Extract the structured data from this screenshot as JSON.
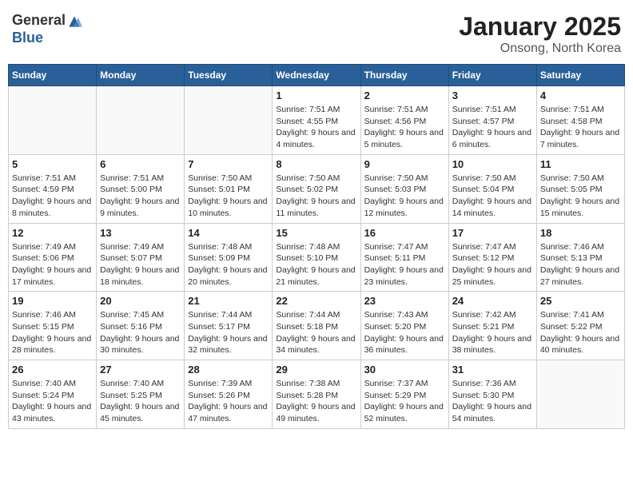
{
  "logo": {
    "general": "General",
    "blue": "Blue"
  },
  "title": "January 2025",
  "subtitle": "Onsong, North Korea",
  "weekdays": [
    "Sunday",
    "Monday",
    "Tuesday",
    "Wednesday",
    "Thursday",
    "Friday",
    "Saturday"
  ],
  "weeks": [
    [
      {
        "day": "",
        "info": ""
      },
      {
        "day": "",
        "info": ""
      },
      {
        "day": "",
        "info": ""
      },
      {
        "day": "1",
        "info": "Sunrise: 7:51 AM\nSunset: 4:55 PM\nDaylight: 9 hours and 4 minutes."
      },
      {
        "day": "2",
        "info": "Sunrise: 7:51 AM\nSunset: 4:56 PM\nDaylight: 9 hours and 5 minutes."
      },
      {
        "day": "3",
        "info": "Sunrise: 7:51 AM\nSunset: 4:57 PM\nDaylight: 9 hours and 6 minutes."
      },
      {
        "day": "4",
        "info": "Sunrise: 7:51 AM\nSunset: 4:58 PM\nDaylight: 9 hours and 7 minutes."
      }
    ],
    [
      {
        "day": "5",
        "info": "Sunrise: 7:51 AM\nSunset: 4:59 PM\nDaylight: 9 hours and 8 minutes."
      },
      {
        "day": "6",
        "info": "Sunrise: 7:51 AM\nSunset: 5:00 PM\nDaylight: 9 hours and 9 minutes."
      },
      {
        "day": "7",
        "info": "Sunrise: 7:50 AM\nSunset: 5:01 PM\nDaylight: 9 hours and 10 minutes."
      },
      {
        "day": "8",
        "info": "Sunrise: 7:50 AM\nSunset: 5:02 PM\nDaylight: 9 hours and 11 minutes."
      },
      {
        "day": "9",
        "info": "Sunrise: 7:50 AM\nSunset: 5:03 PM\nDaylight: 9 hours and 12 minutes."
      },
      {
        "day": "10",
        "info": "Sunrise: 7:50 AM\nSunset: 5:04 PM\nDaylight: 9 hours and 14 minutes."
      },
      {
        "day": "11",
        "info": "Sunrise: 7:50 AM\nSunset: 5:05 PM\nDaylight: 9 hours and 15 minutes."
      }
    ],
    [
      {
        "day": "12",
        "info": "Sunrise: 7:49 AM\nSunset: 5:06 PM\nDaylight: 9 hours and 17 minutes."
      },
      {
        "day": "13",
        "info": "Sunrise: 7:49 AM\nSunset: 5:07 PM\nDaylight: 9 hours and 18 minutes."
      },
      {
        "day": "14",
        "info": "Sunrise: 7:48 AM\nSunset: 5:09 PM\nDaylight: 9 hours and 20 minutes."
      },
      {
        "day": "15",
        "info": "Sunrise: 7:48 AM\nSunset: 5:10 PM\nDaylight: 9 hours and 21 minutes."
      },
      {
        "day": "16",
        "info": "Sunrise: 7:47 AM\nSunset: 5:11 PM\nDaylight: 9 hours and 23 minutes."
      },
      {
        "day": "17",
        "info": "Sunrise: 7:47 AM\nSunset: 5:12 PM\nDaylight: 9 hours and 25 minutes."
      },
      {
        "day": "18",
        "info": "Sunrise: 7:46 AM\nSunset: 5:13 PM\nDaylight: 9 hours and 27 minutes."
      }
    ],
    [
      {
        "day": "19",
        "info": "Sunrise: 7:46 AM\nSunset: 5:15 PM\nDaylight: 9 hours and 28 minutes."
      },
      {
        "day": "20",
        "info": "Sunrise: 7:45 AM\nSunset: 5:16 PM\nDaylight: 9 hours and 30 minutes."
      },
      {
        "day": "21",
        "info": "Sunrise: 7:44 AM\nSunset: 5:17 PM\nDaylight: 9 hours and 32 minutes."
      },
      {
        "day": "22",
        "info": "Sunrise: 7:44 AM\nSunset: 5:18 PM\nDaylight: 9 hours and 34 minutes."
      },
      {
        "day": "23",
        "info": "Sunrise: 7:43 AM\nSunset: 5:20 PM\nDaylight: 9 hours and 36 minutes."
      },
      {
        "day": "24",
        "info": "Sunrise: 7:42 AM\nSunset: 5:21 PM\nDaylight: 9 hours and 38 minutes."
      },
      {
        "day": "25",
        "info": "Sunrise: 7:41 AM\nSunset: 5:22 PM\nDaylight: 9 hours and 40 minutes."
      }
    ],
    [
      {
        "day": "26",
        "info": "Sunrise: 7:40 AM\nSunset: 5:24 PM\nDaylight: 9 hours and 43 minutes."
      },
      {
        "day": "27",
        "info": "Sunrise: 7:40 AM\nSunset: 5:25 PM\nDaylight: 9 hours and 45 minutes."
      },
      {
        "day": "28",
        "info": "Sunrise: 7:39 AM\nSunset: 5:26 PM\nDaylight: 9 hours and 47 minutes."
      },
      {
        "day": "29",
        "info": "Sunrise: 7:38 AM\nSunset: 5:28 PM\nDaylight: 9 hours and 49 minutes."
      },
      {
        "day": "30",
        "info": "Sunrise: 7:37 AM\nSunset: 5:29 PM\nDaylight: 9 hours and 52 minutes."
      },
      {
        "day": "31",
        "info": "Sunrise: 7:36 AM\nSunset: 5:30 PM\nDaylight: 9 hours and 54 minutes."
      },
      {
        "day": "",
        "info": ""
      }
    ]
  ]
}
